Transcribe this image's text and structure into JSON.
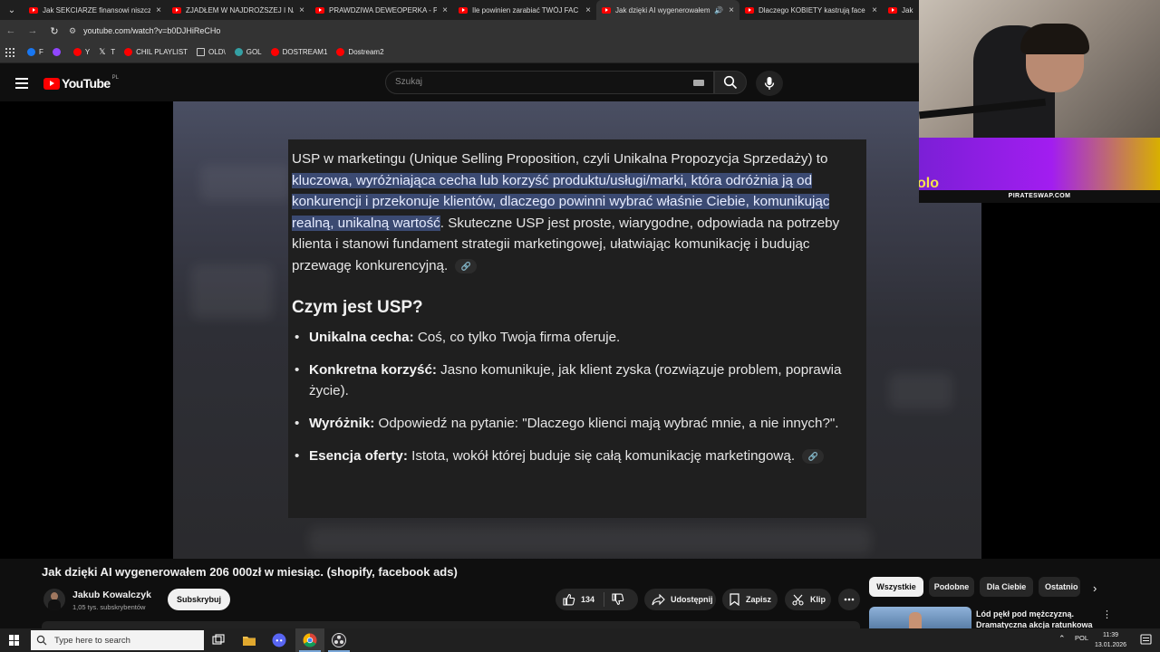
{
  "browser": {
    "tabs": [
      {
        "title": "Jak SEKCIARZE finansowi niszczą",
        "active": false
      },
      {
        "title": "ZJADŁEM W NAJDROŻSZEJ I NAJ",
        "active": false
      },
      {
        "title": "PRAWDZIWA DEWEOPERKA - P",
        "active": false
      },
      {
        "title": "Ile powinien zarabiać TWÓJ FAC",
        "active": false
      },
      {
        "title": "Jak dzięki AI wygenerowałem",
        "active": true
      },
      {
        "title": "Dlaczego KOBIETY kastrują face",
        "active": false
      },
      {
        "title": "Jak",
        "active": false
      }
    ],
    "url": "youtube.com/watch?v=b0DJHiReCHo",
    "bookmarks": [
      {
        "label": "F",
        "icon": "facebook-icon",
        "color": "#1877f2"
      },
      {
        "label": "",
        "icon": "twitch-icon",
        "color": "#9146ff"
      },
      {
        "label": "Y",
        "icon": "youtube-icon",
        "color": "#ff0000"
      },
      {
        "label": "T",
        "icon": "x-icon",
        "color": "#ffffff"
      },
      {
        "label": "CHIL PLAYLIST",
        "icon": "youtube-icon",
        "color": "#ff0000"
      },
      {
        "label": "OLD\\",
        "icon": "folder-icon",
        "color": "#cccccc"
      },
      {
        "label": "GOL",
        "icon": "g-icon",
        "color": "#34a0a4"
      },
      {
        "label": "DOSTREAM1",
        "icon": "youtube-icon",
        "color": "#ff0000"
      },
      {
        "label": "Dostream2",
        "icon": "youtube-icon",
        "color": "#ff0000"
      }
    ]
  },
  "youtube": {
    "logo_text": "YouTube",
    "country_code": "PL",
    "search_placeholder": "Szukaj"
  },
  "video_content": {
    "intro_plain_before": "USP w marketingu (Unique Selling Proposition, czyli Unikalna Propozycja Sprzedaży) to",
    "intro_highlight": " kluczowa, wyróżniająca cecha lub korzyść produktu/usługi/marki, która odróżnia ją od konkurencji i przekonuje klientów, dlaczego powinni wybrać właśnie Ciebie, komunikując realną, unikalną wartość",
    "intro_plain_after": ". Skuteczne USP jest proste, wiarygodne, odpowiada na potrzeby klienta i stanowi fundament strategii marketingowej, ułatwiając komunikację i budując przewagę konkurencyjną.",
    "heading": "Czym jest USP?",
    "bullets": [
      {
        "term": "Unikalna cecha:",
        "text": " Coś, co tylko Twoja firma oferuje."
      },
      {
        "term": "Konkretna korzyść:",
        "text": " Jasno komunikuje, jak klient zyska (rozwiązuje problem, poprawia życie)."
      },
      {
        "term": "Wyróżnik:",
        "text": " Odpowiedź na pytanie: \"Dlaczego klienci mają wybrać mnie, a nie innych?\"."
      },
      {
        "term": "Esencja oferty:",
        "text": " Istota, wokół której buduje się całą komunikację marketingową."
      }
    ]
  },
  "overlay": {
    "banner_text": "PIRATESWAP.COM",
    "banner_logo": "olo"
  },
  "video_info": {
    "title": "Jak dzięki AI wygenerowałem 206 000zł w miesiąc. (shopify, facebook ads)",
    "channel_name": "Jakub Kowalczyk",
    "subscribers": "1,05 tys. subskrybentów",
    "subscribe_label": "Subskrybuj",
    "likes": "134",
    "share_label": "Udostępnij",
    "save_label": "Zapisz",
    "clip_label": "Klip"
  },
  "filters": [
    "Wszystkie",
    "Podobne",
    "Dla Ciebie",
    "Ostatnio"
  ],
  "next_video": {
    "title": "Lód pękł pod mężczyzną. Dramatyczna akcja ratunkowa"
  },
  "taskbar": {
    "search_placeholder": "Type here to search",
    "language": "POL",
    "time": "11:39",
    "date": "13.01.2026"
  }
}
